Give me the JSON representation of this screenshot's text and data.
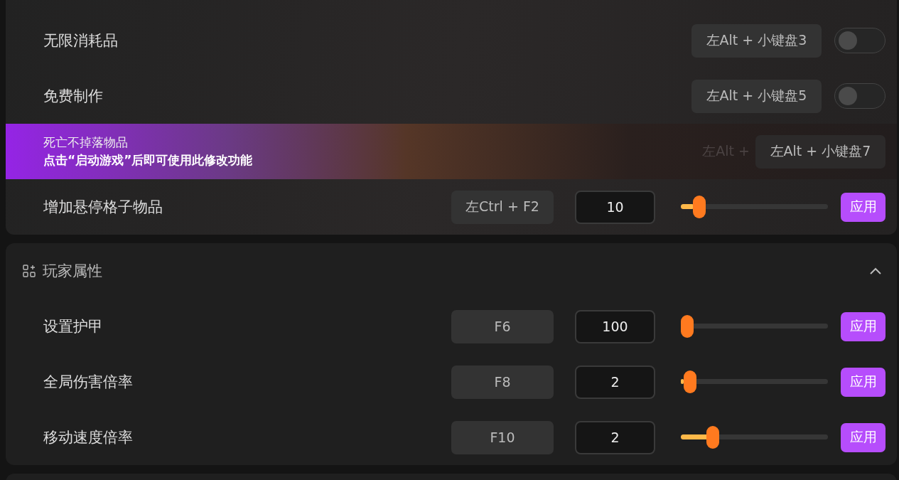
{
  "sections": [
    {
      "rows": [
        {
          "kind": "toggle",
          "label": "无限消耗品",
          "hotkey": "左Alt + 小键盘3",
          "on": false
        },
        {
          "kind": "toggle",
          "label": "免费制作",
          "hotkey": "左Alt + 小键盘5",
          "on": false
        },
        {
          "kind": "locked",
          "notice_title": "死亡不掉落物品",
          "notice_message": "点击“启动游戏”后即可使用此修改功能",
          "covered_hotkey": "左Alt + ",
          "hotkey": "左Alt + 小键盘7"
        },
        {
          "kind": "slider",
          "label": "增加悬停格子物品",
          "hotkey": "左Ctrl + F2",
          "value": "10",
          "level": 0.09,
          "button": "应用"
        }
      ]
    },
    {
      "header": "玩家属性",
      "expanded": true,
      "rows": [
        {
          "kind": "slider",
          "label": "设置护甲",
          "hotkey": "F6",
          "value": "100",
          "level": 0,
          "button": "应用"
        },
        {
          "kind": "slider",
          "label": "全局伤害倍率",
          "hotkey": "F8",
          "value": "2",
          "level": 0.02,
          "button": "应用"
        },
        {
          "kind": "slider",
          "label": "移动速度倍率",
          "hotkey": "F10",
          "value": "2",
          "level": 0.19,
          "button": "应用"
        }
      ]
    }
  ]
}
